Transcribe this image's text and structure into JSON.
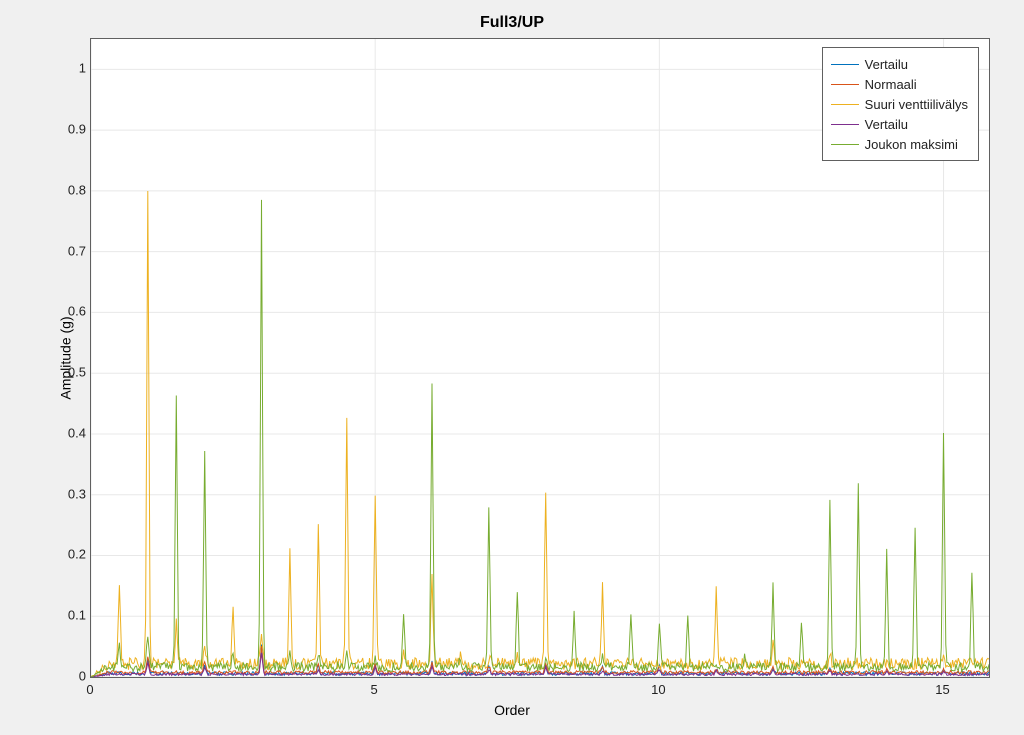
{
  "chart_data": {
    "type": "line",
    "title": "Full3/UP",
    "xlabel": "Order",
    "ylabel": "Amplitude (g)",
    "xlim": [
      0,
      15.8
    ],
    "ylim": [
      0,
      1.05
    ],
    "xticks": [
      0,
      5,
      10,
      15
    ],
    "yticks": [
      0,
      0.1,
      0.2,
      0.3,
      0.4,
      0.5,
      0.6,
      0.7,
      0.8,
      0.9,
      1
    ],
    "legend_position": "top-right",
    "series": [
      {
        "name": "Vertailu",
        "color": "#0072BD",
        "baseline": 0.005,
        "noise": 0.006,
        "peaks": [
          {
            "x": 1.0,
            "y": 0.03
          },
          {
            "x": 2.0,
            "y": 0.02
          },
          {
            "x": 3.0,
            "y": 0.055
          },
          {
            "x": 4.0,
            "y": 0.018
          },
          {
            "x": 5.0,
            "y": 0.02
          },
          {
            "x": 6.0,
            "y": 0.025
          },
          {
            "x": 7.0,
            "y": 0.015
          },
          {
            "x": 8.0,
            "y": 0.02
          },
          {
            "x": 9.0,
            "y": 0.015
          },
          {
            "x": 10.0,
            "y": 0.02
          },
          {
            "x": 11.0,
            "y": 0.012
          },
          {
            "x": 12.0,
            "y": 0.015
          },
          {
            "x": 13.0,
            "y": 0.012
          },
          {
            "x": 14.0,
            "y": 0.012
          },
          {
            "x": 15.0,
            "y": 0.012
          }
        ]
      },
      {
        "name": "Normaali",
        "color": "#D95319",
        "baseline": 0.007,
        "noise": 0.006,
        "peaks": [
          {
            "x": 1.0,
            "y": 0.035
          },
          {
            "x": 2.0,
            "y": 0.025
          },
          {
            "x": 3.0,
            "y": 0.05
          },
          {
            "x": 4.0,
            "y": 0.02
          },
          {
            "x": 5.0,
            "y": 0.02
          },
          {
            "x": 6.0,
            "y": 0.022
          },
          {
            "x": 7.0,
            "y": 0.018
          },
          {
            "x": 8.0,
            "y": 0.02
          },
          {
            "x": 9.0,
            "y": 0.015
          },
          {
            "x": 10.0,
            "y": 0.018
          },
          {
            "x": 11.0,
            "y": 0.012
          },
          {
            "x": 12.0,
            "y": 0.015
          },
          {
            "x": 13.0,
            "y": 0.012
          },
          {
            "x": 14.0,
            "y": 0.012
          },
          {
            "x": 15.0,
            "y": 0.012
          }
        ]
      },
      {
        "name": "Suuri venttiilivälys",
        "color": "#EDB120",
        "baseline": 0.02,
        "noise": 0.02,
        "peaks": [
          {
            "x": 0.5,
            "y": 0.145
          },
          {
            "x": 1.0,
            "y": 0.805
          },
          {
            "x": 1.5,
            "y": 0.09
          },
          {
            "x": 2.0,
            "y": 0.05
          },
          {
            "x": 2.5,
            "y": 0.11
          },
          {
            "x": 3.0,
            "y": 0.06
          },
          {
            "x": 3.5,
            "y": 0.2
          },
          {
            "x": 4.0,
            "y": 0.25
          },
          {
            "x": 4.5,
            "y": 0.43
          },
          {
            "x": 5.0,
            "y": 0.3
          },
          {
            "x": 5.5,
            "y": 0.04
          },
          {
            "x": 6.0,
            "y": 0.175
          },
          {
            "x": 6.5,
            "y": 0.03
          },
          {
            "x": 7.0,
            "y": 0.03
          },
          {
            "x": 7.5,
            "y": 0.03
          },
          {
            "x": 8.0,
            "y": 0.305
          },
          {
            "x": 9.0,
            "y": 0.155
          },
          {
            "x": 11.0,
            "y": 0.145
          },
          {
            "x": 12.0,
            "y": 0.06
          },
          {
            "x": 13.0,
            "y": 0.04
          },
          {
            "x": 14.0,
            "y": 0.025
          },
          {
            "x": 15.0,
            "y": 0.025
          }
        ]
      },
      {
        "name": "Vertailu",
        "color": "#7E2F8E",
        "baseline": 0.004,
        "noise": 0.004,
        "peaks": [
          {
            "x": 1.0,
            "y": 0.025
          },
          {
            "x": 2.0,
            "y": 0.015
          },
          {
            "x": 3.0,
            "y": 0.04
          },
          {
            "x": 4.0,
            "y": 0.012
          },
          {
            "x": 5.0,
            "y": 0.015
          },
          {
            "x": 6.0,
            "y": 0.018
          },
          {
            "x": 7.0,
            "y": 0.012
          },
          {
            "x": 8.0,
            "y": 0.015
          },
          {
            "x": 9.0,
            "y": 0.01
          },
          {
            "x": 10.0,
            "y": 0.012
          },
          {
            "x": 11.0,
            "y": 0.01
          },
          {
            "x": 12.0,
            "y": 0.012
          },
          {
            "x": 13.0,
            "y": 0.01
          },
          {
            "x": 14.0,
            "y": 0.01
          },
          {
            "x": 15.0,
            "y": 0.01
          }
        ]
      },
      {
        "name": "Joukon maksimi",
        "color": "#77AC30",
        "baseline": 0.015,
        "noise": 0.015,
        "peaks": [
          {
            "x": 0.5,
            "y": 0.05
          },
          {
            "x": 1.0,
            "y": 0.07
          },
          {
            "x": 1.5,
            "y": 0.465
          },
          {
            "x": 2.0,
            "y": 0.37
          },
          {
            "x": 2.5,
            "y": 0.04
          },
          {
            "x": 3.0,
            "y": 0.78
          },
          {
            "x": 3.5,
            "y": 0.04
          },
          {
            "x": 4.0,
            "y": 0.04
          },
          {
            "x": 4.5,
            "y": 0.035
          },
          {
            "x": 5.0,
            "y": 0.035
          },
          {
            "x": 5.5,
            "y": 0.1
          },
          {
            "x": 6.0,
            "y": 0.48
          },
          {
            "x": 6.5,
            "y": 0.03
          },
          {
            "x": 7.0,
            "y": 0.28
          },
          {
            "x": 7.5,
            "y": 0.14
          },
          {
            "x": 8.0,
            "y": 0.03
          },
          {
            "x": 8.5,
            "y": 0.1
          },
          {
            "x": 9.0,
            "y": 0.03
          },
          {
            "x": 9.5,
            "y": 0.105
          },
          {
            "x": 10.0,
            "y": 0.09
          },
          {
            "x": 10.5,
            "y": 0.105
          },
          {
            "x": 11.0,
            "y": 0.025
          },
          {
            "x": 11.5,
            "y": 0.03
          },
          {
            "x": 12.0,
            "y": 0.15
          },
          {
            "x": 12.5,
            "y": 0.095
          },
          {
            "x": 13.0,
            "y": 0.29
          },
          {
            "x": 13.5,
            "y": 0.32
          },
          {
            "x": 14.0,
            "y": 0.215
          },
          {
            "x": 14.5,
            "y": 0.25
          },
          {
            "x": 15.0,
            "y": 0.4
          },
          {
            "x": 15.5,
            "y": 0.17
          }
        ]
      }
    ]
  }
}
